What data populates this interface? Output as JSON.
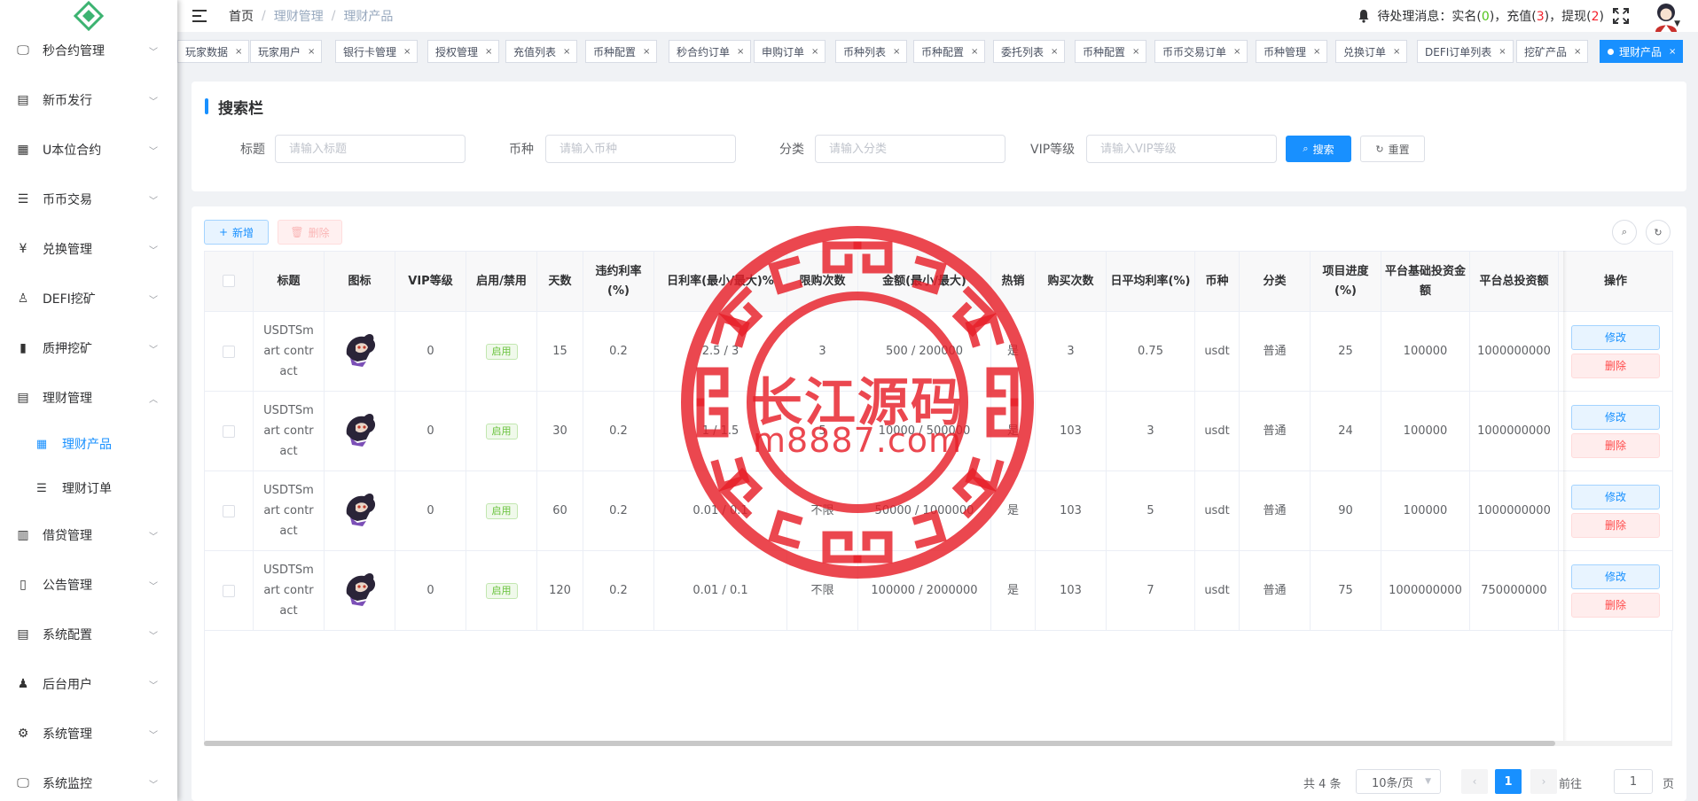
{
  "sidebar": {
    "items": [
      {
        "label": "秒合约管理",
        "icon": "monitor-icon",
        "glyph": "🖵"
      },
      {
        "label": "新币发行",
        "icon": "document-icon",
        "glyph": "▤"
      },
      {
        "label": "U本位合约",
        "icon": "grid-icon",
        "glyph": "▦"
      },
      {
        "label": "币币交易",
        "icon": "list-icon",
        "glyph": "☰"
      },
      {
        "label": "兑换管理",
        "icon": "yen-icon",
        "glyph": "¥"
      },
      {
        "label": "DEFI挖矿",
        "icon": "user-icon",
        "glyph": "♙"
      },
      {
        "label": "质押挖矿",
        "icon": "bar-chart-icon",
        "glyph": "▮"
      },
      {
        "label": "理财管理",
        "icon": "file-icon",
        "glyph": "▤"
      },
      {
        "label": "借贷管理",
        "icon": "book-icon",
        "glyph": "▥"
      },
      {
        "label": "公告管理",
        "icon": "open-book-icon",
        "glyph": "▯"
      },
      {
        "label": "系统配置",
        "icon": "file-icon",
        "glyph": "▤"
      },
      {
        "label": "后台用户",
        "icon": "users-icon",
        "glyph": "♟"
      },
      {
        "label": "系统管理",
        "icon": "gear-icon",
        "glyph": "⚙"
      },
      {
        "label": "系统监控",
        "icon": "monitor-icon",
        "glyph": "🖵"
      }
    ],
    "sub_items": [
      {
        "label": "理财产品",
        "icon": "product-icon",
        "glyph": "▦"
      },
      {
        "label": "理财订单",
        "icon": "list-icon",
        "glyph": "☰"
      }
    ]
  },
  "header": {
    "breadcrumb": [
      "首页",
      "理财管理",
      "理财产品"
    ],
    "notice_prefix": "待处理消息：实名(",
    "realname_count": "0",
    "notice_mid1": ")，充值(",
    "recharge_count": "3",
    "notice_mid2": ")，提现(",
    "withdraw_count": "2",
    "notice_suffix": ")"
  },
  "tags": [
    "玩家数据",
    "玩家用户",
    "银行卡管理",
    "授权管理",
    "充值列表",
    "币种配置",
    "秒合约订单",
    "申购订单",
    "币种列表",
    "币种配置",
    "委托列表",
    "币种配置",
    "币币交易订单",
    "币种管理",
    "兑换订单",
    "DEFI订单列表",
    "挖矿产品",
    "理财产品"
  ],
  "search": {
    "title": "搜索栏",
    "fields": [
      {
        "label": "标题",
        "placeholder": "请输入标题"
      },
      {
        "label": "币种",
        "placeholder": "请输入币种"
      },
      {
        "label": "分类",
        "placeholder": "请输入分类"
      },
      {
        "label": "VIP等级",
        "placeholder": "请输入VIP等级"
      }
    ],
    "search_btn": "搜索",
    "reset_btn": "重置"
  },
  "toolbar": {
    "add_label": "新增",
    "delete_label": "删除"
  },
  "table": {
    "headers": [
      "标题",
      "图标",
      "VIP等级",
      "启用/禁用",
      "天数",
      "违约利率(%)",
      "日利率(最小/最大)%",
      "限购次数",
      "金额(最小/最大)",
      "热销",
      "购买次数",
      "日平均利率(%)",
      "币种",
      "分类",
      "项目进度(%)",
      "平台基础投资金额",
      "平台总投资额",
      "操作"
    ],
    "enable_label": "启用",
    "edit_label": "修改",
    "delete_label": "删除",
    "rows": [
      {
        "title": "USDTSmart contract",
        "vip": "0",
        "days": "15",
        "penalty": "0.2",
        "daily_rate": "2.5 / 3",
        "limit": "3",
        "amount": "500 / 200000",
        "hot": "是",
        "buy_count": "3",
        "avg_rate": "0.75",
        "coin": "usdt",
        "category": "普通",
        "progress": "25",
        "base_invest": "100000",
        "total_invest": "1000000000"
      },
      {
        "title": "USDTSmart contract",
        "vip": "0",
        "days": "30",
        "penalty": "0.2",
        "daily_rate": "1 / 1.5",
        "limit": "5",
        "amount": "10000 / 500000",
        "hot": "是",
        "buy_count": "103",
        "avg_rate": "3",
        "coin": "usdt",
        "category": "普通",
        "progress": "24",
        "base_invest": "100000",
        "total_invest": "1000000000"
      },
      {
        "title": "USDTSmart contract",
        "vip": "0",
        "days": "60",
        "penalty": "0.2",
        "daily_rate": "0.01 / 0.1",
        "limit": "不限",
        "amount": "50000 / 1000000",
        "hot": "是",
        "buy_count": "103",
        "avg_rate": "5",
        "coin": "usdt",
        "category": "普通",
        "progress": "90",
        "base_invest": "100000",
        "total_invest": "1000000000"
      },
      {
        "title": "USDTSmart contract",
        "vip": "0",
        "days": "120",
        "penalty": "0.2",
        "daily_rate": "0.01 / 0.1",
        "limit": "不限",
        "amount": "100000 / 2000000",
        "hot": "是",
        "buy_count": "103",
        "avg_rate": "7",
        "coin": "usdt",
        "category": "普通",
        "progress": "75",
        "base_invest": "1000000000",
        "total_invest": "750000000"
      }
    ]
  },
  "pagination": {
    "total": "共 4 条",
    "page_size": "10条/页",
    "current_page": "1",
    "goto_label": "前往",
    "goto_value": "1",
    "page_unit": "页"
  },
  "watermark": {
    "line1": "长江源码",
    "line2": "m8887.com"
  },
  "colors": {
    "primary": "#1890ff",
    "success": "#67c23a",
    "danger": "#ff4949",
    "watermark": "#e61e28"
  }
}
